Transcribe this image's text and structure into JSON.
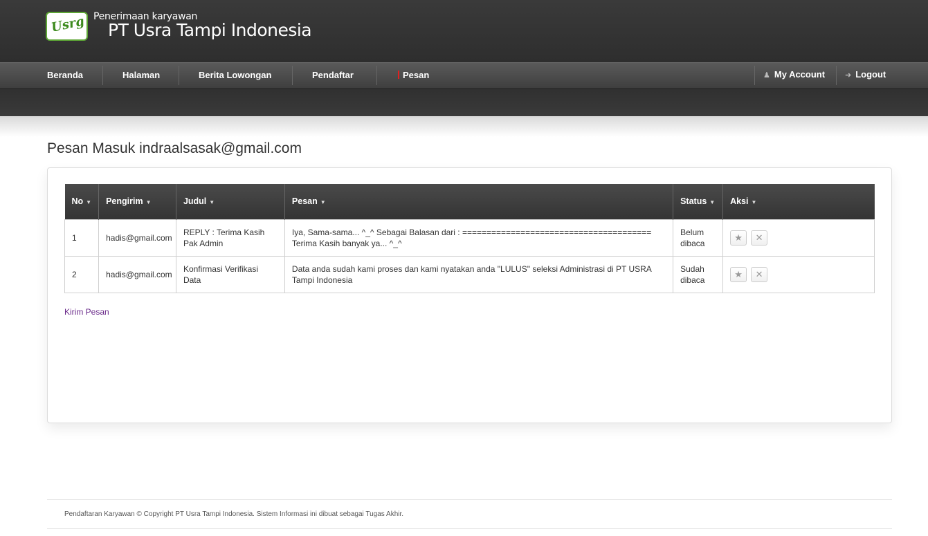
{
  "header": {
    "logo_text": "Usrg",
    "subtitle": "Penerimaan karyawan",
    "title": "PT Usra Tampi Indonesia"
  },
  "nav": {
    "items": [
      {
        "label": "Beranda"
      },
      {
        "label": "Halaman"
      },
      {
        "label": "Berita Lowongan"
      },
      {
        "label": "Pendaftar"
      },
      {
        "label": "Pesan"
      }
    ],
    "my_account": "My Account",
    "logout": "Logout",
    "account_icon": "user-icon",
    "logout_icon": "arrow-right-icon"
  },
  "main": {
    "title": "Pesan Masuk indraalsasak@gmail.com",
    "table": {
      "columns": [
        "No",
        "Pengirim",
        "Judul",
        "Pesan",
        "Status",
        "Aksi"
      ],
      "rows": [
        {
          "no": "1",
          "pengirim": "hadis@gmail.com",
          "judul": "REPLY : Terima Kasih Pak Admin",
          "pesan": "Iya, Sama-sama... ^_^ Sebagai Balasan dari : ======================================= Terima Kasih banyak ya... ^_^",
          "status": "Belum dibaca"
        },
        {
          "no": "2",
          "pengirim": "hadis@gmail.com",
          "judul": "Konfirmasi Verifikasi Data",
          "pesan": "Data anda sudah kami proses dan kami nyatakan anda \"LULUS\" seleksi Administrasi di PT USRA Tampi Indonesia",
          "status": "Sudah dibaca"
        }
      ]
    },
    "send_link": "Kirim Pesan"
  },
  "footer": {
    "text": "Pendaftaran Karyawan © Copyright PT Usra Tampi Indonesia. Sistem Informasi ini dibuat sebagai Tugas Akhir."
  },
  "colors": {
    "header_bg": "#2e2e2e",
    "nav_bg": "#4a4a4a",
    "link": "#6a2a8a",
    "accent_red": "#e02020",
    "logo_green": "#5da535"
  }
}
